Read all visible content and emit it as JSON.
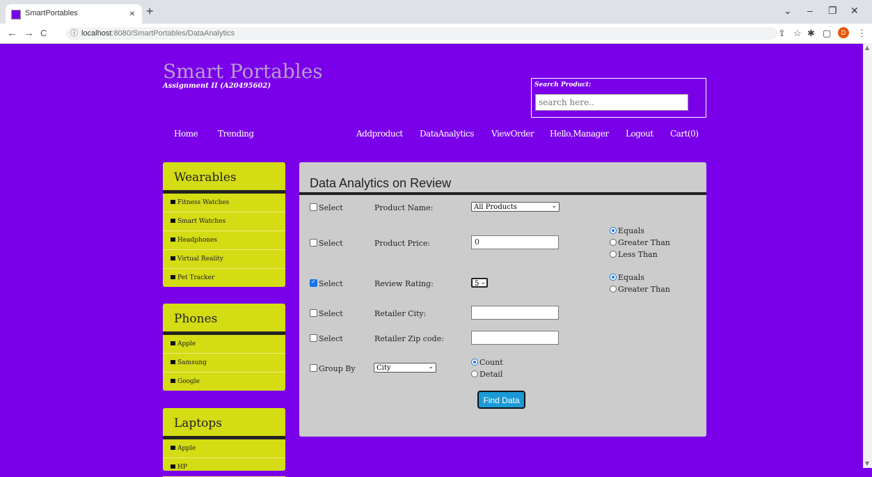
{
  "browser": {
    "tab_title": "SmartPortables",
    "url_host": "localhost",
    "url_rest": ":8080/SmartPortables/DataAnalytics",
    "avatar_letter": "D"
  },
  "site": {
    "logo": "Smart Portables",
    "subtitle": "Assignment II (A20495602)",
    "search_label": "Search Product:",
    "search_placeholder": "search here..",
    "nav": [
      "Home",
      "Trending",
      "Addproduct",
      "DataAnalytics",
      "ViewOrder",
      "Hello,Manager",
      "Logout",
      "Cart(0)"
    ]
  },
  "sidebar": {
    "wearables": {
      "title": "Wearables",
      "items": [
        "Fitness Watches",
        "Smart Watches",
        "Headphones",
        "Virtual Reality",
        "Pet Tracker"
      ]
    },
    "phones": {
      "title": "Phones",
      "items": [
        "Apple",
        "Samsung",
        "Google"
      ]
    },
    "laptops": {
      "title": "Laptops",
      "items": [
        "Apple",
        "HP"
      ]
    }
  },
  "panel": {
    "title": "Data Analytics on Review",
    "select_label": "Select",
    "group_by_label": "Group By",
    "product_name_label": "Product Name:",
    "product_name_value": "All Products",
    "product_price_label": "Product Price:",
    "product_price_value": "0",
    "review_rating_label": "Review Rating:",
    "review_rating_value": "5",
    "retailer_city_label": "Retailer City:",
    "retailer_zip_label": "Retailer Zip code:",
    "group_by_value": "City",
    "price_options": [
      "Equals",
      "Greater Than",
      "Less Than"
    ],
    "rating_options": [
      "Equals",
      "Greater Than"
    ],
    "group_options": [
      "Count",
      "Detail"
    ],
    "find_button": "Find Data"
  }
}
